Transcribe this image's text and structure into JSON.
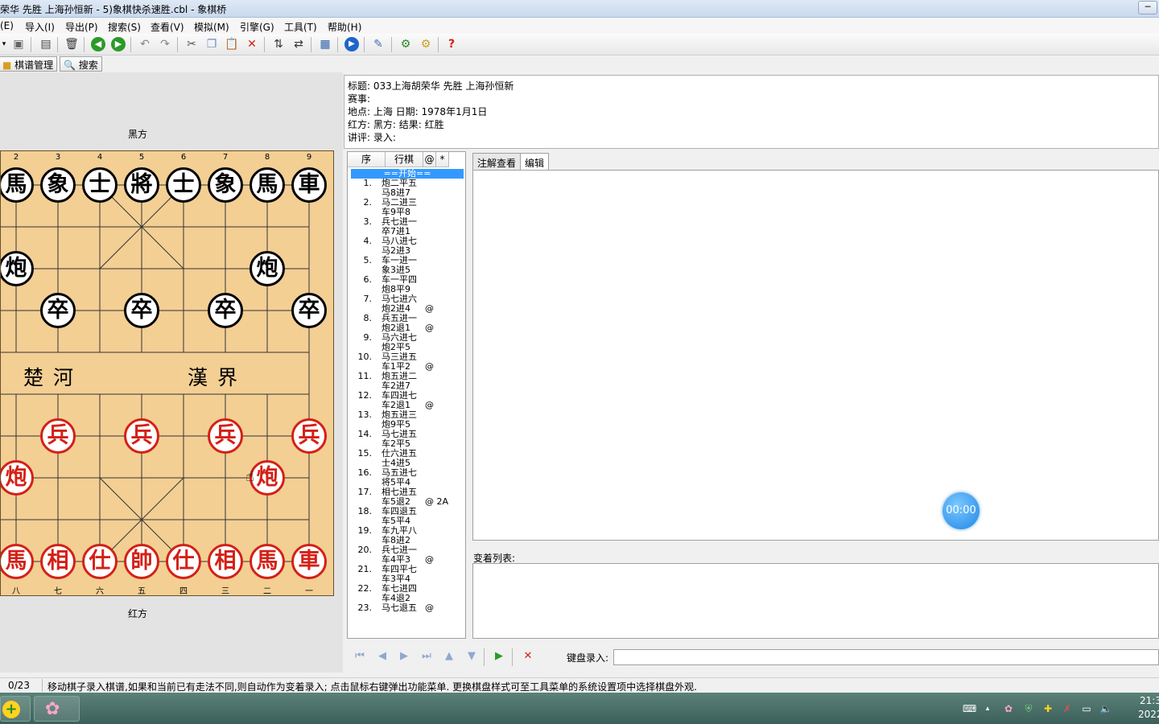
{
  "window": {
    "title": "荣华 先胜 上海孙恒新 - 5)象棋快杀速胜.cbl - 象棋桥",
    "minimize_label": "─"
  },
  "menu": [
    "(E)",
    "导入(I)",
    "导出(P)",
    "搜索(S)",
    "查看(V)",
    "模拟(M)",
    "引擎(G)",
    "工具(T)",
    "帮助(H)"
  ],
  "toolbar_icons": [
    "dropdown-icon",
    "save-icon",
    "properties-icon",
    "delete-icon",
    "back-icon",
    "forward-icon",
    "undo-icon",
    "redo-icon",
    "cut-icon",
    "copy-icon",
    "paste-icon",
    "remove-icon",
    "flip-vertical-icon",
    "flip-horizontal-icon",
    "board-icon",
    "play-icon",
    "book-icon",
    "engine-icon",
    "engine-settings-icon",
    "help-icon"
  ],
  "tabs": {
    "manage": "棋谱管理",
    "search": "搜索"
  },
  "board": {
    "top_label": "黑方",
    "bottom_label": "红方",
    "river_left": "楚 河",
    "river_right": "漢 界",
    "top_files": [
      "2",
      "3",
      "4",
      "5",
      "6",
      "7",
      "8",
      "9"
    ],
    "bottom_files": [
      "八",
      "七",
      "六",
      "五",
      "四",
      "三",
      "二",
      "一"
    ],
    "black": [
      {
        "ch": "馬",
        "c": 1,
        "r": 0
      },
      {
        "ch": "象",
        "c": 2,
        "r": 0
      },
      {
        "ch": "士",
        "c": 3,
        "r": 0
      },
      {
        "ch": "將",
        "c": 4,
        "r": 0
      },
      {
        "ch": "士",
        "c": 5,
        "r": 0
      },
      {
        "ch": "象",
        "c": 6,
        "r": 0
      },
      {
        "ch": "馬",
        "c": 7,
        "r": 0
      },
      {
        "ch": "車",
        "c": 8,
        "r": 0
      },
      {
        "ch": "炮",
        "c": 1,
        "r": 2
      },
      {
        "ch": "炮",
        "c": 7,
        "r": 2
      },
      {
        "ch": "卒",
        "c": 2,
        "r": 3
      },
      {
        "ch": "卒",
        "c": 4,
        "r": 3
      },
      {
        "ch": "卒",
        "c": 6,
        "r": 3
      },
      {
        "ch": "卒",
        "c": 8,
        "r": 3
      }
    ],
    "red": [
      {
        "ch": "兵",
        "c": 2,
        "r": 6
      },
      {
        "ch": "兵",
        "c": 4,
        "r": 6
      },
      {
        "ch": "兵",
        "c": 6,
        "r": 6
      },
      {
        "ch": "兵",
        "c": 8,
        "r": 6
      },
      {
        "ch": "炮",
        "c": 1,
        "r": 7
      },
      {
        "ch": "炮",
        "c": 7,
        "r": 7
      },
      {
        "ch": "馬",
        "c": 1,
        "r": 9
      },
      {
        "ch": "相",
        "c": 2,
        "r": 9
      },
      {
        "ch": "仕",
        "c": 3,
        "r": 9
      },
      {
        "ch": "帥",
        "c": 4,
        "r": 9
      },
      {
        "ch": "仕",
        "c": 5,
        "r": 9
      },
      {
        "ch": "相",
        "c": 6,
        "r": 9
      },
      {
        "ch": "馬",
        "c": 7,
        "r": 9
      },
      {
        "ch": "車",
        "c": 8,
        "r": 9
      }
    ]
  },
  "info": {
    "line1": "标题: 033上海胡荣华 先胜 上海孙恒新",
    "line2": "赛事:",
    "line3": "地点: 上海    日期: 1978年1月1日",
    "line4": "红方:    黑方:    结果: 红胜",
    "line5": "讲评:    录入:"
  },
  "movelist": {
    "headers": [
      "序",
      "行棋",
      "@",
      "*"
    ],
    "start": "==开始==",
    "moves": [
      {
        "n": "1.",
        "r": "炮二平五",
        "b": "马8进7",
        "m": ""
      },
      {
        "n": "2.",
        "r": "马二进三",
        "b": "车9平8",
        "m": ""
      },
      {
        "n": "3.",
        "r": "兵七进一",
        "b": "卒7进1",
        "m": ""
      },
      {
        "n": "4.",
        "r": "马八进七",
        "b": "马2进3",
        "m": ""
      },
      {
        "n": "5.",
        "r": "车一进一",
        "b": "象3进5",
        "m": ""
      },
      {
        "n": "6.",
        "r": "车一平四",
        "b": "炮8平9",
        "m": ""
      },
      {
        "n": "7.",
        "r": "马七进六",
        "b": "炮2进4",
        "m": "@"
      },
      {
        "n": "8.",
        "r": "兵五进一",
        "b": "炮2退1",
        "m": "@"
      },
      {
        "n": "9.",
        "r": "马六进七",
        "b": "炮2平5",
        "m": ""
      },
      {
        "n": "10.",
        "r": "马三进五",
        "b": "车1平2",
        "m": "@"
      },
      {
        "n": "11.",
        "r": "炮五进二",
        "b": "车2进7",
        "m": ""
      },
      {
        "n": "12.",
        "r": "车四进七",
        "b": "车2退1",
        "m": "@"
      },
      {
        "n": "13.",
        "r": "炮五进三",
        "b": "炮9平5",
        "m": ""
      },
      {
        "n": "14.",
        "r": "马七进五",
        "b": "车2平5",
        "m": ""
      },
      {
        "n": "15.",
        "r": "仕六进五",
        "b": "士4进5",
        "m": ""
      },
      {
        "n": "16.",
        "r": "马五进七",
        "b": "将5平4",
        "m": ""
      },
      {
        "n": "17.",
        "r": "相七进五",
        "b": "车5退2",
        "m": "@ 2A"
      },
      {
        "n": "18.",
        "r": "车四退五",
        "b": "车5平4",
        "m": ""
      },
      {
        "n": "19.",
        "r": "车九平八",
        "b": "车8进2",
        "m": ""
      },
      {
        "n": "20.",
        "r": "兵七进一",
        "b": "车4平3",
        "m": "@"
      },
      {
        "n": "21.",
        "r": "车四平七",
        "b": "车3平4",
        "m": ""
      },
      {
        "n": "22.",
        "r": "车七进四",
        "b": "车4退2",
        "m": ""
      },
      {
        "n": "23.",
        "r": "马七退五",
        "b": "",
        "m": "@"
      }
    ]
  },
  "right": {
    "tab_comment": "注解查看",
    "tab_edit": "编辑",
    "variations_label": "变着列表:",
    "timer": "00:00"
  },
  "nav": {
    "keyboard_label": "键盘录入:"
  },
  "status": {
    "position": "0/23",
    "message": "移动棋子录入棋谱,如果和当前已有走法不同,则自动作为变着录入; 点击鼠标右键弹出功能菜单. 更换棋盘样式可至工具菜单的系统设置项中选择棋盘外观."
  },
  "taskbar": {
    "clock_time": "21:3",
    "clock_date": "2022"
  }
}
